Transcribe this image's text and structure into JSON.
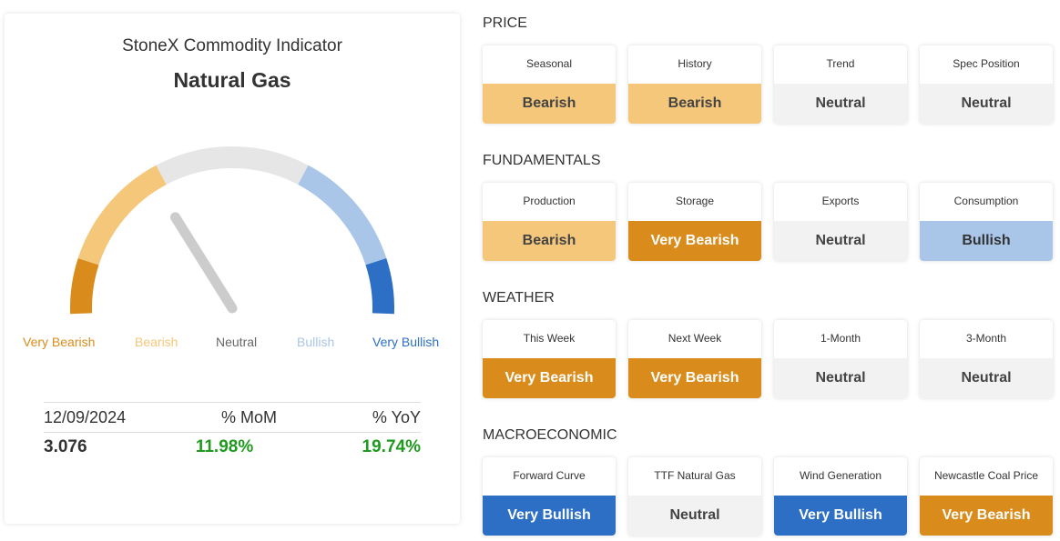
{
  "indicator": {
    "title": "StoneX Commodity Indicator",
    "commodity": "Natural Gas",
    "gauge_level": "Bearish",
    "scale_labels": [
      "Very Bearish",
      "Bearish",
      "Neutral",
      "Bullish",
      "Very Bullish"
    ],
    "colors": {
      "very_bearish": "#d98c1c",
      "bearish": "#f5c77b",
      "neutral": "#e6e6e6",
      "bullish": "#a9c6e8",
      "very_bullish": "#2c6fc4",
      "needle": "#cccccc",
      "positive": "#1f9a1f"
    }
  },
  "stats": {
    "date": "12/09/2024",
    "mom_label": "% MoM",
    "yoy_label": "% YoY",
    "price": "3.076",
    "mom": "11.98%",
    "yoy": "19.74%"
  },
  "sections": [
    {
      "title": "PRICE",
      "tiles": [
        {
          "label": "Seasonal",
          "value": "Bearish"
        },
        {
          "label": "History",
          "value": "Bearish"
        },
        {
          "label": "Trend",
          "value": "Neutral"
        },
        {
          "label": "Spec Position",
          "value": "Neutral"
        }
      ]
    },
    {
      "title": "FUNDAMENTALS",
      "tiles": [
        {
          "label": "Production",
          "value": "Bearish"
        },
        {
          "label": "Storage",
          "value": "Very Bearish"
        },
        {
          "label": "Exports",
          "value": "Neutral"
        },
        {
          "label": "Consumption",
          "value": "Bullish"
        }
      ]
    },
    {
      "title": "WEATHER",
      "tiles": [
        {
          "label": "This Week",
          "value": "Very Bearish"
        },
        {
          "label": "Next Week",
          "value": "Very Bearish"
        },
        {
          "label": "1-Month",
          "value": "Neutral"
        },
        {
          "label": "3-Month",
          "value": "Neutral"
        }
      ]
    },
    {
      "title": "MACROECONOMIC",
      "tiles": [
        {
          "label": "Forward Curve",
          "value": "Very Bullish"
        },
        {
          "label": "TTF Natural Gas",
          "value": "Neutral"
        },
        {
          "label": "Wind Generation",
          "value": "Very Bullish"
        },
        {
          "label": "Newcastle Coal Price",
          "value": "Very Bearish"
        }
      ]
    }
  ]
}
